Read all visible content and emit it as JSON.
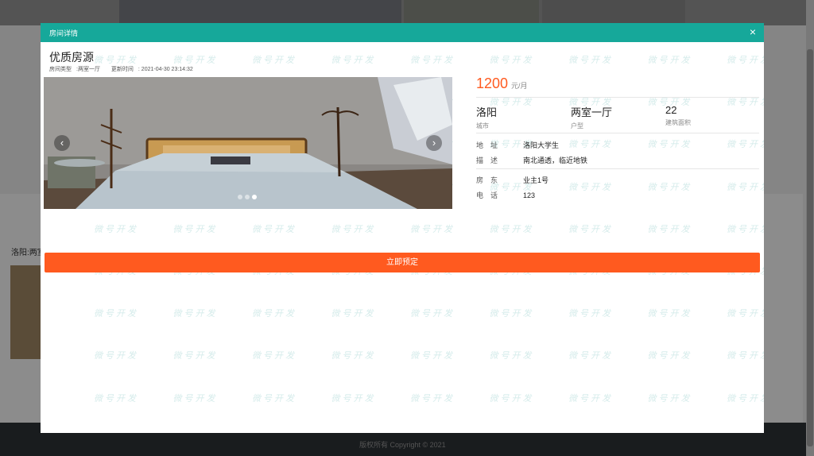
{
  "background": {
    "card_title": "洛阳:两室",
    "footer_line1": "",
    "footer_line2": "版权所有    Copyright © 2021"
  },
  "modal": {
    "title": "房间详情",
    "close": "×",
    "watermark": "微号开发",
    "room_title": "优质房源",
    "meta": {
      "type_label": "房间类型",
      "type_value": ":两室一厅",
      "update_label": "更新时间",
      "update_value": ": 2021-04-30 23:14:32"
    },
    "carousel": {
      "prev": "‹",
      "next": "›",
      "slide_count": 3,
      "active_index": 2
    },
    "price": "1200",
    "price_unit": "元/月",
    "stats": [
      {
        "value": "洛阳",
        "label": "城市"
      },
      {
        "value": "两室一厅",
        "label": "户型"
      },
      {
        "value": "22",
        "label": "建筑面积"
      }
    ],
    "details": {
      "address_label": "地址",
      "address_value": "洛阳大学生",
      "desc_label": "描述",
      "desc_value": "南北通透，临近地铁",
      "landlord_label": "房东",
      "landlord_value": "业主1号",
      "phone_label": "电话",
      "phone_value": "123"
    },
    "book_button": "立即预定"
  }
}
